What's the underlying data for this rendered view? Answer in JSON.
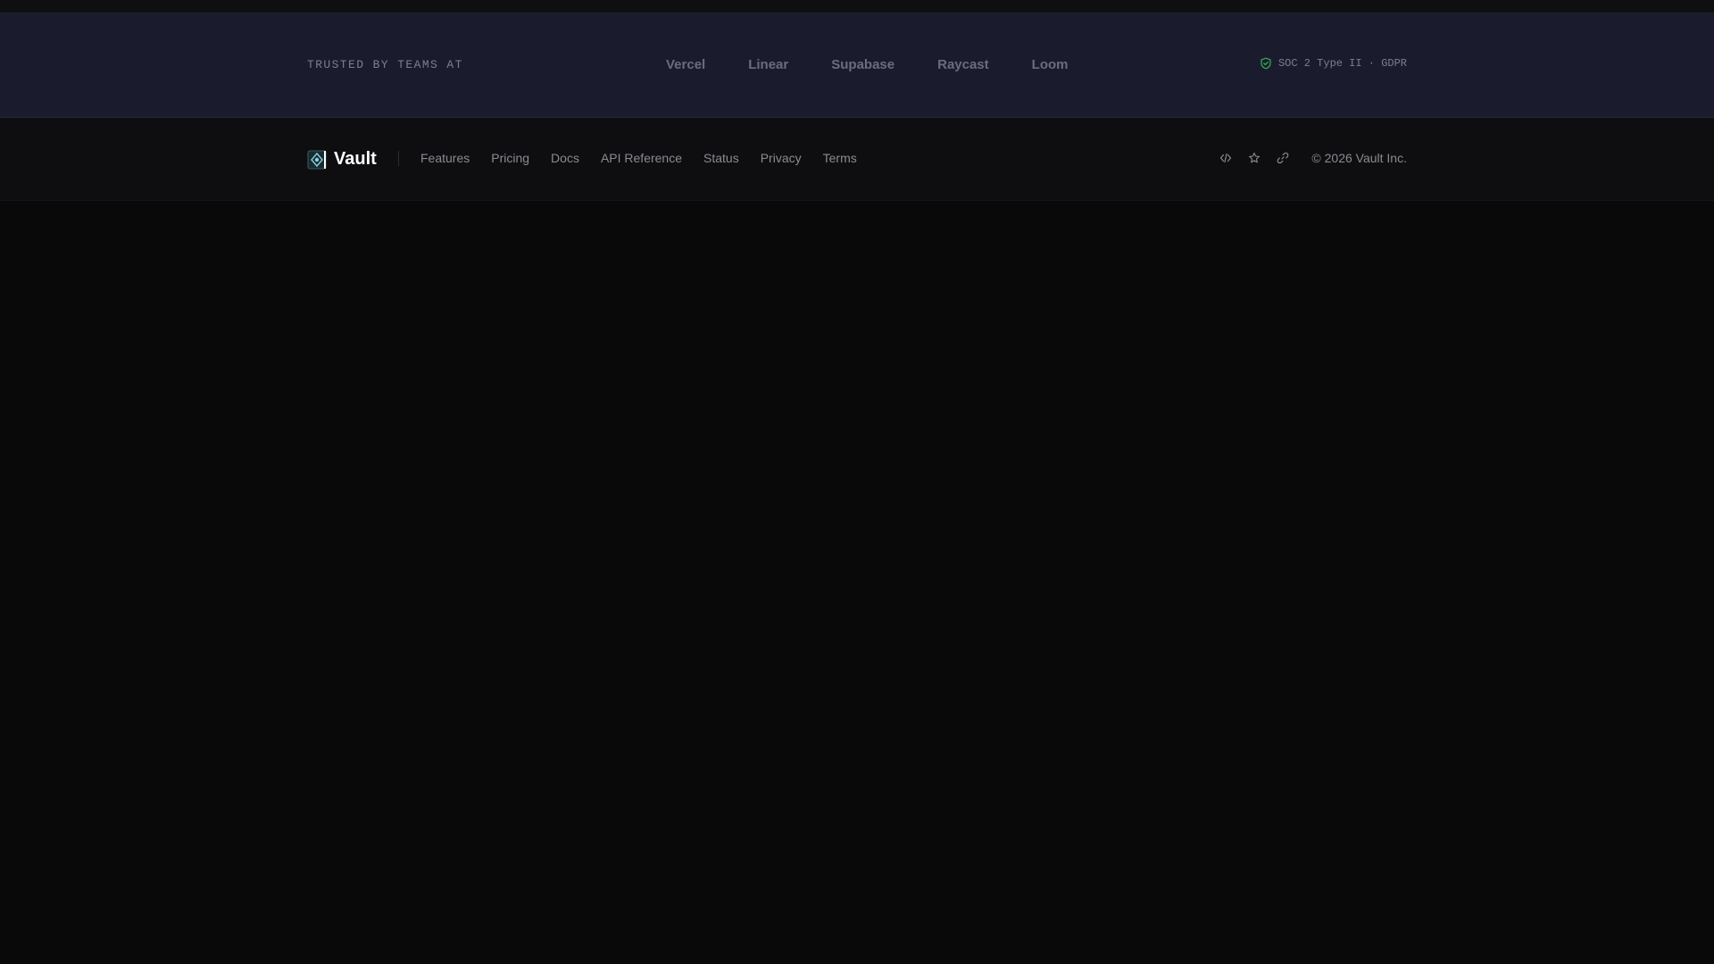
{
  "trusted": {
    "label": "TRUSTED BY TEAMS AT",
    "logos": [
      "Vercel",
      "Linear",
      "Supabase",
      "Raycast",
      "Loom"
    ],
    "compliance": "SOC 2 Type II · GDPR"
  },
  "footer": {
    "brand": "Vault",
    "nav": [
      "Features",
      "Pricing",
      "Docs",
      "API Reference",
      "Status",
      "Privacy",
      "Terms"
    ],
    "icons": [
      "code-icon",
      "star-icon",
      "link-icon"
    ],
    "copyright": "© 2026 Vault Inc."
  },
  "colors": {
    "trusted_bg": "#1a1c2e",
    "footer_bg": "#0e0e10",
    "page_bg": "#09090a",
    "accent_green": "#34a853"
  }
}
